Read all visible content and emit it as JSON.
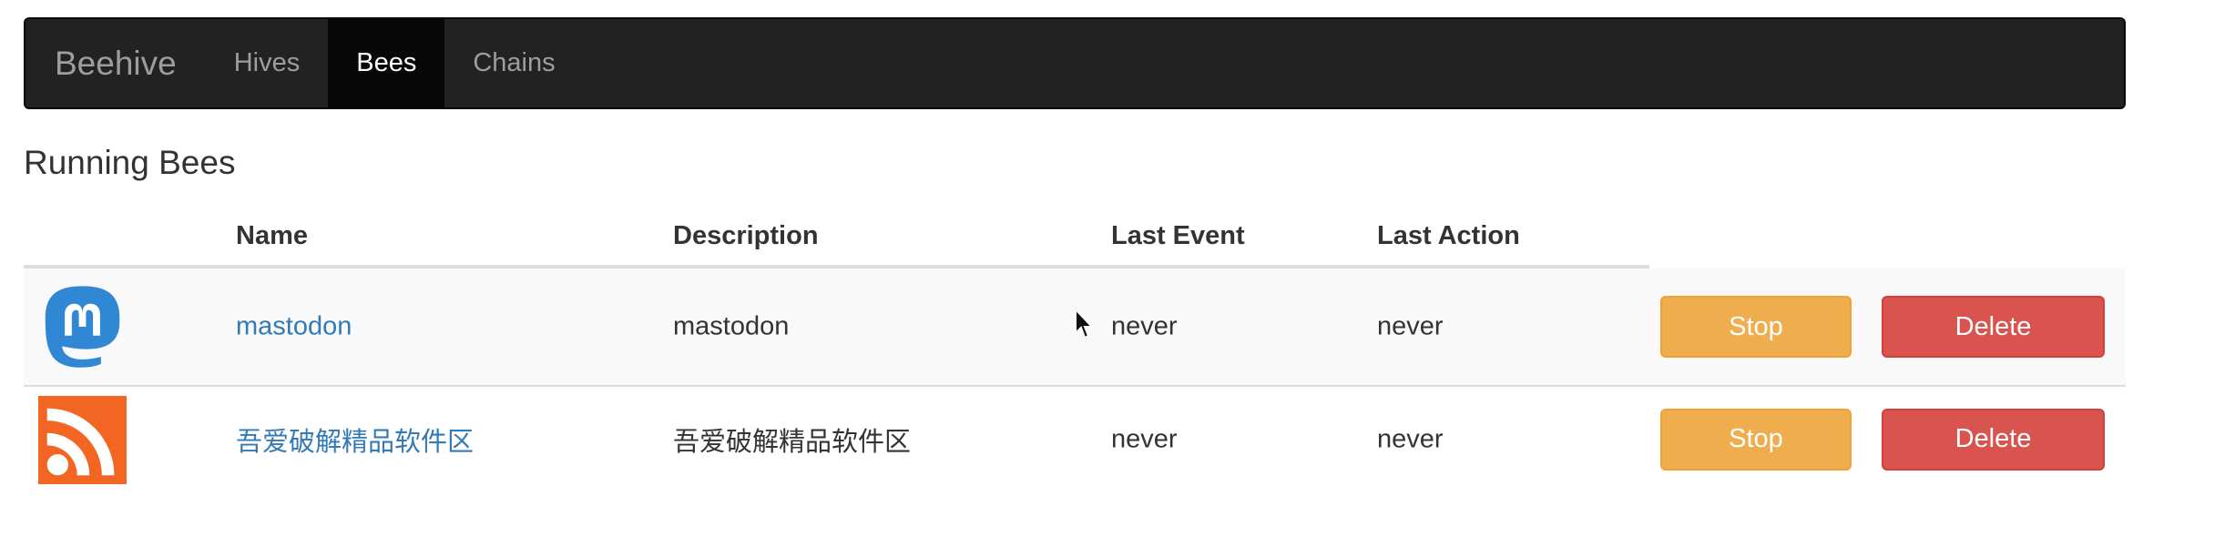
{
  "navbar": {
    "brand": "Beehive",
    "items": [
      {
        "label": "Hives",
        "active": false
      },
      {
        "label": "Bees",
        "active": true
      },
      {
        "label": "Chains",
        "active": false
      }
    ]
  },
  "page": {
    "title": "Running Bees"
  },
  "table": {
    "columns": [
      "Name",
      "Description",
      "Last Event",
      "Last Action"
    ],
    "rows": [
      {
        "icon": "mastodon-icon",
        "name": "mastodon",
        "description": "mastodon",
        "last_event": "never",
        "last_action": "never",
        "stop_label": "Stop",
        "delete_label": "Delete"
      },
      {
        "icon": "rss-icon",
        "name": "吾爱破解精品软件区",
        "description": "吾爱破解精品软件区",
        "last_event": "never",
        "last_action": "never",
        "stop_label": "Stop",
        "delete_label": "Delete"
      }
    ]
  },
  "colors": {
    "navbar_bg": "#222222",
    "link": "#337ab7",
    "stop_button": "#f0ad4e",
    "delete_button": "#d9534f",
    "mastodon_brand": "#3088d4",
    "rss_brand": "#f26522"
  }
}
